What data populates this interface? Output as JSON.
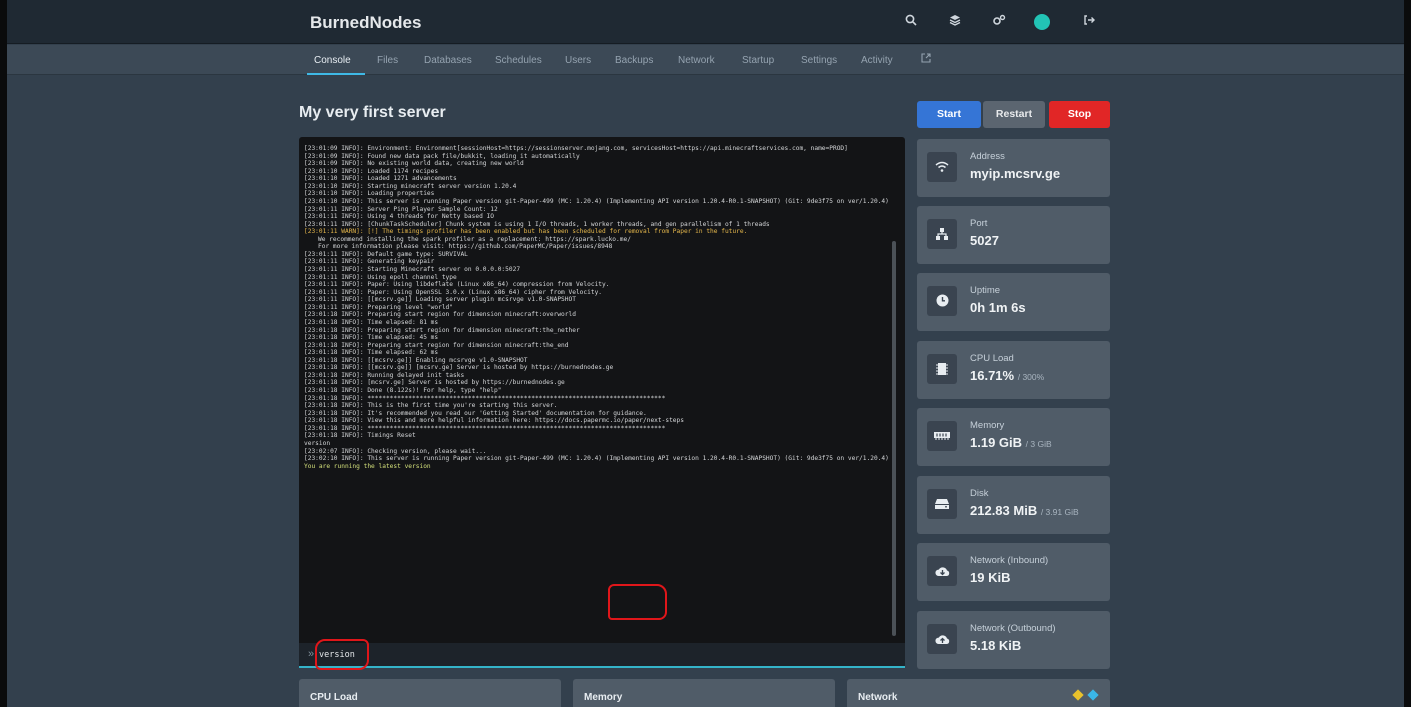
{
  "brand": "BurnedNodes",
  "nav": {
    "tabs": [
      "Console",
      "Files",
      "Databases",
      "Schedules",
      "Users",
      "Backups",
      "Network",
      "Startup",
      "Settings",
      "Activity"
    ],
    "active": "Console"
  },
  "server": {
    "title": "My very first server"
  },
  "controls": {
    "start": "Start",
    "restart": "Restart",
    "stop": "Stop"
  },
  "console": {
    "lines": [
      {
        "text": "[23:01:09 INFO]: Environment: Environment[sessionHost=https://sessionserver.mojang.com, servicesHost=https://api.minecraftservices.com, name=PROD]",
        "kind": "plain"
      },
      {
        "text": "[23:01:09 INFO]: Found new data pack file/bukkit, loading it automatically",
        "kind": "plain"
      },
      {
        "text": "[23:01:09 INFO]: No existing world data, creating new world",
        "kind": "plain"
      },
      {
        "text": "[23:01:10 INFO]: Loaded 1174 recipes",
        "kind": "plain"
      },
      {
        "text": "[23:01:10 INFO]: Loaded 1271 advancements",
        "kind": "plain"
      },
      {
        "text": "[23:01:10 INFO]: Starting minecraft server version 1.20.4",
        "kind": "plain"
      },
      {
        "text": "[23:01:10 INFO]: Loading properties",
        "kind": "plain"
      },
      {
        "text": "[23:01:10 INFO]: This server is running Paper version git-Paper-499 (MC: 1.20.4) (Implementing API version 1.20.4-R0.1-SNAPSHOT) (Git: 9de3f75 on ver/1.20.4)",
        "kind": "plain"
      },
      {
        "text": "[23:01:11 INFO]: Server Ping Player Sample Count: 12",
        "kind": "plain"
      },
      {
        "text": "[23:01:11 INFO]: Using 4 threads for Netty based IO",
        "kind": "plain"
      },
      {
        "text": "[23:01:11 INFO]: [ChunkTaskScheduler] Chunk system is using 1 I/O threads, 1 worker threads, and gen parallelism of 1 threads",
        "kind": "plain"
      },
      {
        "text": "[23:01:11 WARN]: [!] The timings profiler has been enabled but has been scheduled for removal from Paper in the future.",
        "kind": "warn"
      },
      {
        "text": "We recommend installing the spark profiler as a replacement: https://spark.lucko.me/",
        "kind": "sub"
      },
      {
        "text": "For more information please visit: https://github.com/PaperMC/Paper/issues/8948",
        "kind": "sub"
      },
      {
        "text": "[23:01:11 INFO]: Default game type: SURVIVAL",
        "kind": "plain"
      },
      {
        "text": "[23:01:11 INFO]: Generating keypair",
        "kind": "plain"
      },
      {
        "text": "[23:01:11 INFO]: Starting Minecraft server on 0.0.0.0:5027",
        "kind": "plain"
      },
      {
        "text": "[23:01:11 INFO]: Using epoll channel type",
        "kind": "plain"
      },
      {
        "text": "[23:01:11 INFO]: Paper: Using libdeflate (Linux x86_64) compression from Velocity.",
        "kind": "plain"
      },
      {
        "text": "[23:01:11 INFO]: Paper: Using OpenSSL 3.0.x (Linux x86_64) cipher from Velocity.",
        "kind": "plain"
      },
      {
        "text": "[23:01:11 INFO]: [[mcsrv.ge]] Loading server plugin mcsrvge v1.0-SNAPSHOT",
        "kind": "plain"
      },
      {
        "text": "[23:01:11 INFO]: Preparing level \"world\"",
        "kind": "plain"
      },
      {
        "text": "[23:01:18 INFO]: Preparing start region for dimension minecraft:overworld",
        "kind": "plain"
      },
      {
        "text": "[23:01:18 INFO]: Time elapsed: 81 ms",
        "kind": "plain"
      },
      {
        "text": "[23:01:18 INFO]: Preparing start region for dimension minecraft:the_nether",
        "kind": "plain"
      },
      {
        "text": "[23:01:18 INFO]: Time elapsed: 45 ms",
        "kind": "plain"
      },
      {
        "text": "[23:01:18 INFO]: Preparing start region for dimension minecraft:the_end",
        "kind": "plain"
      },
      {
        "text": "[23:01:18 INFO]: Time elapsed: 62 ms",
        "kind": "plain"
      },
      {
        "text": "[23:01:18 INFO]: [[mcsrv.ge]] Enabling mcsrvge v1.0-SNAPSHOT",
        "kind": "plain"
      },
      {
        "text": "[23:01:18 INFO]: [[mcsrv.ge]] [mcsrv.ge] Server is hosted by https://burnednodes.ge",
        "kind": "plain"
      },
      {
        "text": "[23:01:18 INFO]: Running delayed init tasks",
        "kind": "plain"
      },
      {
        "text": "[23:01:18 INFO]: [mcsrv.ge] Server is hosted by https://burnednodes.ge",
        "kind": "plain"
      },
      {
        "text": "[23:01:18 INFO]: Done (8.122s)! For help, type \"help\"",
        "kind": "plain"
      },
      {
        "text": "[23:01:18 INFO]: ********************************************************************************",
        "kind": "plain"
      },
      {
        "text": "[23:01:18 INFO]: This is the first time you're starting this server.",
        "kind": "plain"
      },
      {
        "text": "[23:01:18 INFO]: It's recommended you read our 'Getting Started' documentation for guidance.",
        "kind": "plain"
      },
      {
        "text": "[23:01:18 INFO]: View this and more helpful information here: https://docs.papermc.io/paper/next-steps",
        "kind": "plain"
      },
      {
        "text": "[23:01:18 INFO]: ********************************************************************************",
        "kind": "plain"
      },
      {
        "text": "[23:01:18 INFO]: Timings Reset",
        "kind": "plain"
      },
      {
        "text": "version",
        "kind": "plain"
      },
      {
        "text": "[23:02:07 INFO]: Checking version, please wait...",
        "kind": "plain"
      },
      {
        "text": "[23:02:10 INFO]: This server is running Paper version git-Paper-499 (MC: 1.20.4) (Implementing API version 1.20.4-R0.1-SNAPSHOT) (Git: 9de3f75 on ver/1.20.4)",
        "kind": "plain"
      },
      {
        "text": "You are running the latest version",
        "kind": "ok"
      }
    ],
    "command_value": "version"
  },
  "stats": {
    "address": {
      "label": "Address",
      "value": "myip.mcsrv.ge",
      "icon": "wifi-icon"
    },
    "port": {
      "label": "Port",
      "value": "5027",
      "icon": "network-icon"
    },
    "uptime": {
      "label": "Uptime",
      "value": "0h 1m 6s",
      "icon": "clock-icon"
    },
    "cpu": {
      "label": "CPU Load",
      "value": "16.71%",
      "limit": "/ 300%",
      "icon": "cpu-icon"
    },
    "memory": {
      "label": "Memory",
      "value": "1.19 GiB",
      "limit": "/ 3 GiB",
      "icon": "memory-icon"
    },
    "disk": {
      "label": "Disk",
      "value": "212.83 MiB",
      "limit": "/ 3.91 GiB",
      "icon": "disk-icon"
    },
    "net_in": {
      "label": "Network (Inbound)",
      "value": "19 KiB",
      "icon": "cloud-download-icon"
    },
    "net_out": {
      "label": "Network (Outbound)",
      "value": "5.18 KiB",
      "icon": "cloud-upload-icon"
    }
  },
  "bottom_cards": {
    "cpu": "CPU Load",
    "memory": "Memory",
    "network": "Network"
  },
  "colors": {
    "accent": "#3fb9e6",
    "start": "#3575d6",
    "stop": "#e12626",
    "annotation": "#e0161a"
  }
}
